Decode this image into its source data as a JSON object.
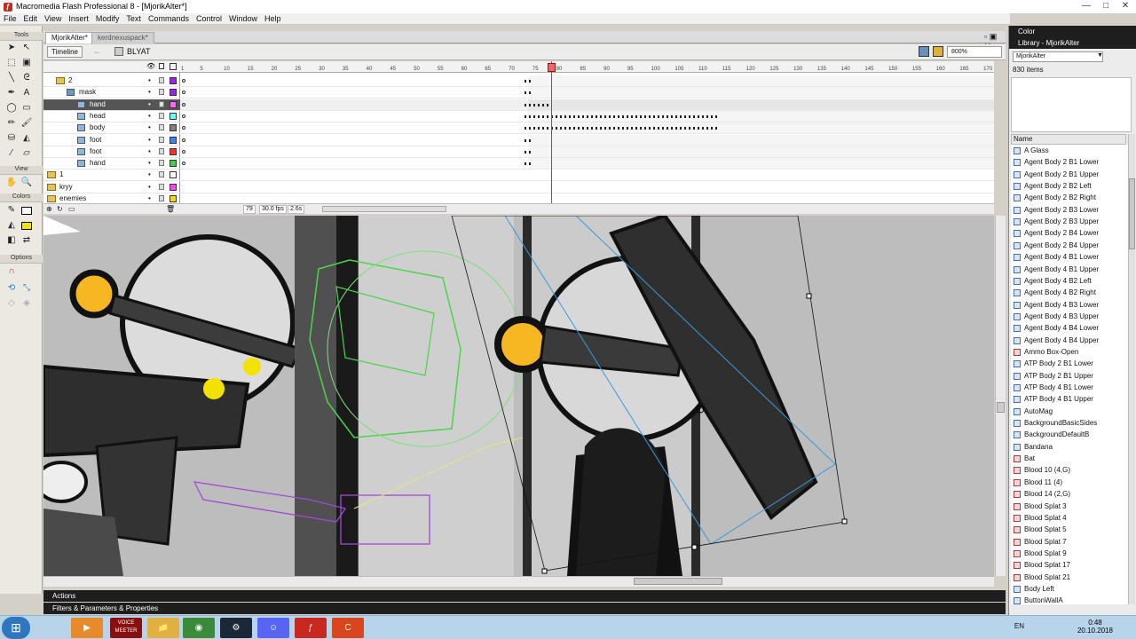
{
  "app": {
    "title": "Macromedia Flash Professional 8 - [MjorikAlter*]",
    "window_min": "—",
    "window_max": "□",
    "window_close": "✕"
  },
  "menu": [
    "File",
    "Edit",
    "View",
    "Insert",
    "Modify",
    "Text",
    "Commands",
    "Control",
    "Window",
    "Help"
  ],
  "tools": {
    "header": "Tools",
    "view_label": "View",
    "colors_label": "Colors",
    "options_label": "Options"
  },
  "tabs": [
    "MjorikAlter*",
    "kerdnexuspack*"
  ],
  "timeline": {
    "button": "Timeline",
    "scene_name": "BLYAT",
    "zoom": "800%",
    "ruler": [
      "1",
      "5",
      "10",
      "15",
      "20",
      "25",
      "30",
      "35",
      "40",
      "45",
      "50",
      "55",
      "60",
      "65",
      "70",
      "75",
      "80",
      "85",
      "90",
      "95",
      "100",
      "105",
      "110",
      "115",
      "120",
      "125",
      "130",
      "135",
      "140",
      "145",
      "150",
      "155",
      "160",
      "165",
      "170"
    ],
    "layers": [
      {
        "name": "2",
        "type": "folder"
      },
      {
        "name": "mask",
        "type": "mask"
      },
      {
        "name": "hand",
        "type": "layer",
        "selected": true
      },
      {
        "name": "head",
        "type": "layer"
      },
      {
        "name": "body",
        "type": "layer"
      },
      {
        "name": "foot",
        "type": "layer"
      },
      {
        "name": "foot",
        "type": "layer"
      },
      {
        "name": "hand",
        "type": "layer"
      },
      {
        "name": "1",
        "type": "folder"
      },
      {
        "name": "kryy",
        "type": "folder"
      },
      {
        "name": "enemies",
        "type": "folder"
      }
    ],
    "layer_colors": [
      "#a020f0",
      "#a020f0",
      "#ff66ff",
      "#66ffff",
      "#808080",
      "#4080ff",
      "#ff3030",
      "#40d040",
      "#ffffff",
      "#ff40ff",
      "#ffd700"
    ],
    "status": {
      "frame": "79",
      "fps": "30.0 fps",
      "time": "2.6s"
    }
  },
  "panels": {
    "actions": "Actions",
    "filters": "Filters & Parameters & Properties",
    "color": "Color",
    "library": "Library - MjorikAlter"
  },
  "library": {
    "selected": "MjorikAlter",
    "count": "830 items",
    "name_header": "Name",
    "items": [
      "A Glass",
      "Agent Body 2 B1 Lower",
      "Agent Body 2 B1 Upper",
      "Agent Body 2 B2 Left",
      "Agent Body 2 B2 Right",
      "Agent Body 2 B3 Lower",
      "Agent Body 2 B3 Upper",
      "Agent Body 2 B4 Lower",
      "Agent Body 2 B4 Upper",
      "Agent Body 4 B1 Lower",
      "Agent Body 4 B1 Upper",
      "Agent Body 4 B2 Left",
      "Agent Body 4 B2 Right",
      "Agent Body 4 B3 Lower",
      "Agent Body 4 B3 Upper",
      "Agent Body 4 B4 Lower",
      "Agent Body 4 B4 Upper",
      "Ammo Box-Open",
      "ATP Body 2 B1 Lower",
      "ATP Body 2 B1 Upper",
      "ATP Body 4 B1 Lower",
      "ATP Body 4 B1 Upper",
      "AutoMag",
      "BackgroundBasicSides",
      "BackgroundDefaultB",
      "Bandana",
      "Bat",
      "Blood 10 (4,G)",
      "Blood 11 (4)",
      "Blood 14 (2,G)",
      "Blood Splat 3",
      "Blood Splat 4",
      "Blood Splat 5",
      "Blood Splat 7",
      "Blood Splat 9",
      "Blood Splat 17",
      "Blood Splat 21",
      "Body Left",
      "ButtonWallA"
    ],
    "bitmap_items": [
      17,
      26,
      27,
      28,
      29,
      30,
      31,
      32,
      33,
      34,
      35,
      36
    ]
  },
  "taskbar": {
    "apps": [
      "⊞",
      "▶",
      "VOICE MEETER",
      "📁",
      "◉",
      "⚙",
      "☺",
      "ƒ",
      "C"
    ],
    "lang": "EN",
    "time": "0:48",
    "date": "20.10.2018"
  },
  "colors": {
    "accent_playhead": "#d03030",
    "selection": "#3a9ad9",
    "flash_red": "#c8281e"
  }
}
